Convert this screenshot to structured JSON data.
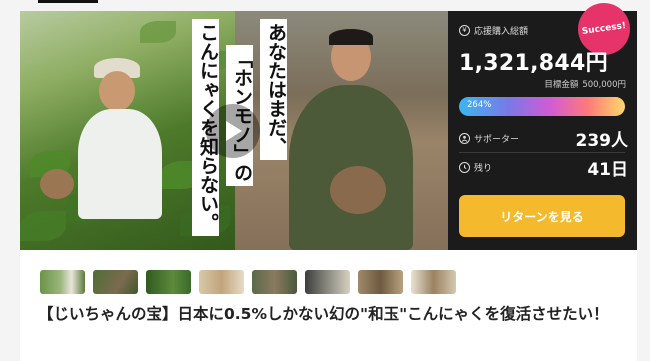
{
  "hero": {
    "copy_lines": [
      "あなたはまだ、",
      "「ホンモノ」の",
      "こんにゃくを知らない。"
    ]
  },
  "stats": {
    "success_badge": "Success!",
    "amount_label": "応援購入総額",
    "amount": "1,321,844円",
    "target_label": "目標金額",
    "target_value": "500,000円",
    "progress_label": "264%",
    "progress_percent": 264,
    "supporters_label": "サポーター",
    "supporters_value": "239人",
    "remaining_label": "残り",
    "remaining_value": "41日",
    "cta_label": "リターンを見る"
  },
  "thumbnails": [
    "thumb-1",
    "thumb-2",
    "thumb-3",
    "thumb-4",
    "thumb-5",
    "thumb-6",
    "thumb-7",
    "thumb-8"
  ],
  "project": {
    "title": "【じいちゃんの宝】日本に0.5%しかない幻の\"和玉\"こんにゃくを復活させたい！"
  },
  "colors": {
    "stats_bg": "#1b1b1b",
    "cta": "#f4b92c",
    "success": "#e6346a"
  }
}
